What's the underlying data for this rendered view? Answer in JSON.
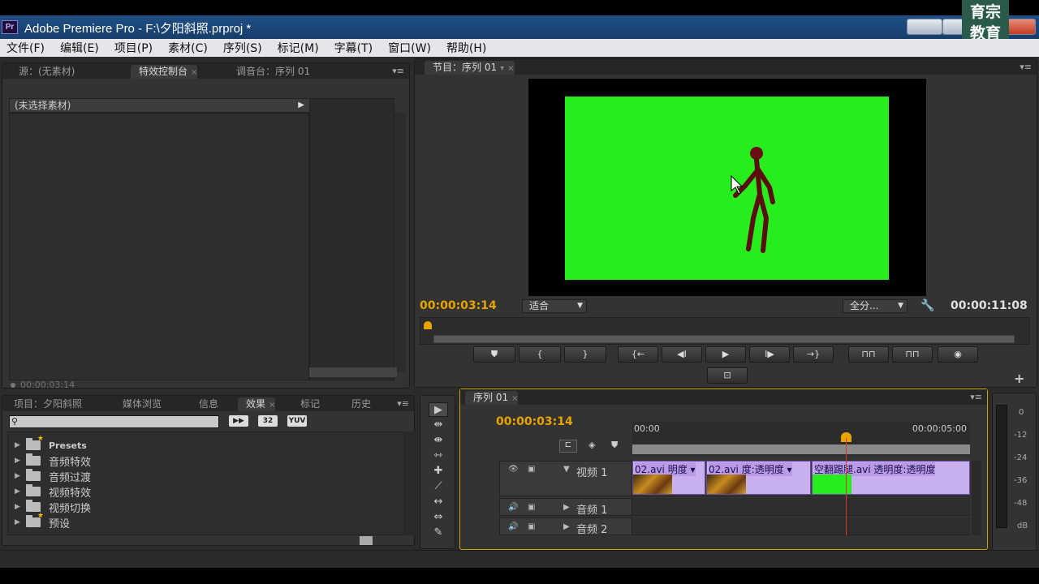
{
  "titlebar": {
    "logo": "Pr",
    "title": "Adobe Premiere Pro - F:\\夕阳斜照.prproj *"
  },
  "watermark": {
    "line1": "育宗",
    "line2": "教育"
  },
  "menu": [
    "文件(F)",
    "编辑(E)",
    "项目(P)",
    "素材(C)",
    "序列(S)",
    "标记(M)",
    "字幕(T)",
    "窗口(W)",
    "帮助(H)"
  ],
  "left_panel": {
    "tabs": [
      "源：(无素材)",
      "特效控制台",
      "调音台：序列 01"
    ],
    "header": "(未选择素材)",
    "timecode": "00:00:03:14"
  },
  "program": {
    "tab": "节目：序列 01",
    "timecode": "00:00:03:14",
    "fit": "适合",
    "quality": "全分...",
    "duration": "00:00:11:08",
    "buttons": [
      "⛊",
      "{",
      "}",
      "{←",
      "◀I",
      "▶",
      "I▶",
      "→}",
      "⊓⊓",
      "⊓⊓",
      "◉"
    ]
  },
  "effects_panel": {
    "tabs": [
      "项目：夕阳斜照",
      "媒体浏览",
      "信息",
      "效果",
      "标记",
      "历史"
    ],
    "buttons": [
      "▶▶",
      "32",
      "YUV"
    ],
    "tree": [
      "Presets",
      "音频特效",
      "音频过渡",
      "视频特效",
      "视频切换",
      "预设"
    ]
  },
  "tools": [
    "▶",
    "⇹",
    "⇼",
    "⇿",
    "✚",
    "⟋",
    "↔",
    "⇔",
    "✎",
    "✋"
  ],
  "timeline": {
    "tab": "序列 01",
    "timecode": "00:00:03:14",
    "ruler_start": "00:00",
    "ruler_end": "00:00:05:00",
    "tracks": [
      "视频 1",
      "音频 1",
      "音频 2"
    ],
    "clips": [
      {
        "label": "02.avi 明度 ▾",
        "thumb": "footage"
      },
      {
        "label": "02.avi 度:透明度 ▾",
        "thumb": "footage"
      },
      {
        "label": "空翻踢腿.avi 透明度:透明度",
        "thumb": "green"
      }
    ]
  },
  "meter": {
    "labels": [
      "0",
      "-12",
      "-24",
      "-36",
      "-48",
      "dB"
    ]
  }
}
